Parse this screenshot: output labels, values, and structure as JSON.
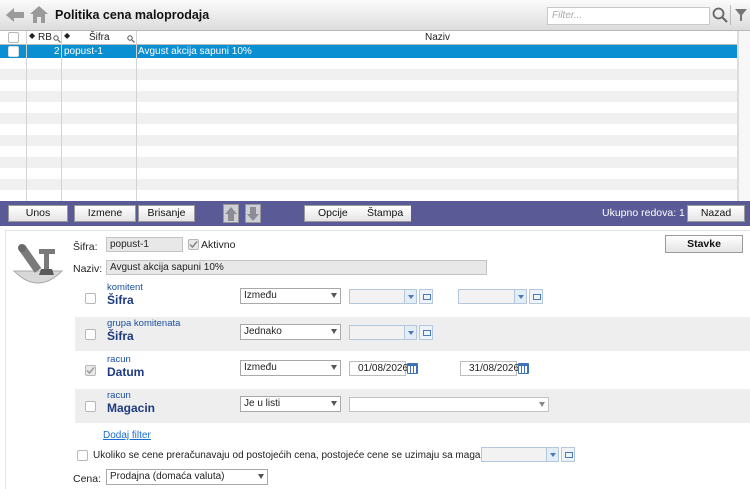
{
  "header": {
    "title": "Politika cena maloprodaja",
    "filter_placeholder": "Filter..."
  },
  "grid": {
    "columns": [
      "RB",
      "Šifra",
      "Naziv"
    ],
    "rows": [
      {
        "rb": "2",
        "sifra": "popust-1",
        "naziv": "Avgust akcija sapuni 10%"
      }
    ]
  },
  "toolbar": {
    "unos": "Unos",
    "izmene": "Izmene",
    "brisanje": "Brisanje",
    "opcije": "Opcije",
    "stampa": "Štampa",
    "total_label": "Ukupno redova: 1",
    "nazad": "Nazad"
  },
  "form": {
    "sifra_label": "Šifra:",
    "sifra_value": "popust-1",
    "aktivno_label": "Aktivno",
    "naziv_label": "Naziv:",
    "naziv_value": "Avgust akcija sapuni 10%",
    "stavke": "Stavke",
    "filters": [
      {
        "group": "komitent",
        "field": "Šifra",
        "operator": "Između",
        "checked": false
      },
      {
        "group": "grupa komitenata",
        "field": "Šifra",
        "operator": "Jednako",
        "checked": false
      },
      {
        "group": "racun",
        "field": "Datum",
        "operator": "Između",
        "checked": true,
        "from": "01/08/2026",
        "to": "31/08/2026"
      },
      {
        "group": "racun",
        "field": "Magacin",
        "operator": "Je u listi",
        "checked": false
      }
    ],
    "add_filter": "Dodaj filter",
    "recalc_label": "Ukoliko se cene preračunavaju od postojećih cena, postojeće cene se uzimaju sa magacina:",
    "cena_label": "Cena:",
    "cena_value": "Prodajna (domaća valuta)"
  },
  "colors": {
    "toolbar": "#5a5a96",
    "selection": "#0a8fd3",
    "caption": "#1e3a80"
  }
}
